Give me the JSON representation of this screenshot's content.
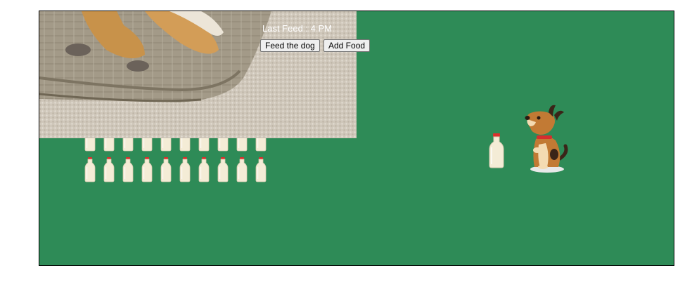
{
  "game": {
    "status_label": "Last Feed : 4 PM",
    "buttons": {
      "feed": "Feed the dog",
      "add": "Add Food"
    },
    "food_stock_rows_visible": 2,
    "bottles_per_row": 10,
    "colors": {
      "background": "#2e8b57",
      "bottle_cap": "#d9302c",
      "bottle_body": "#f4ecd6"
    },
    "icons": {
      "milk": "milk-bottle-icon",
      "dog": "dog-sitting-icon"
    }
  }
}
